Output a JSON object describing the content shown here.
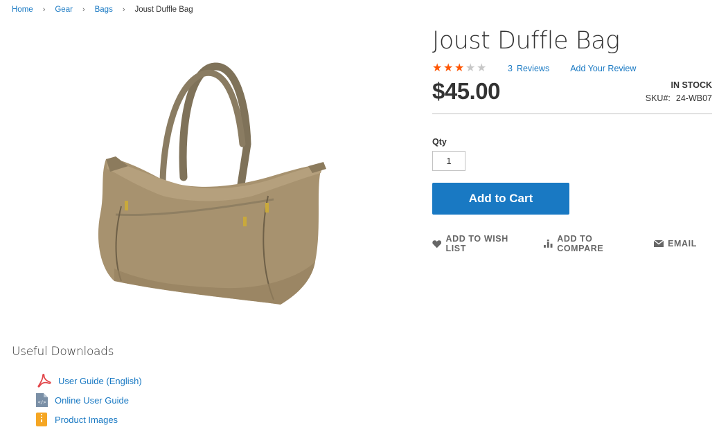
{
  "breadcrumbs": {
    "items": [
      "Home",
      "Gear",
      "Bags"
    ],
    "separator": "›",
    "current": "Joust Duffle Bag"
  },
  "product": {
    "title": "Joust Duffle Bag",
    "rating": 3,
    "rating_max": 5,
    "reviews_count": "3",
    "reviews_label": "Reviews",
    "add_review_label": "Add Your Review",
    "price": "$45.00",
    "stock_status": "IN STOCK",
    "sku_label": "SKU#:",
    "sku": "24-WB07",
    "image_icon": "duffle-bag-image"
  },
  "purchase": {
    "qty_label": "Qty",
    "qty_value": "1",
    "add_to_cart_label": "Add to Cart"
  },
  "actions": {
    "wishlist_label": "ADD TO WISH LIST",
    "compare_label": "ADD TO COMPARE",
    "email_label": "EMAIL"
  },
  "downloads": {
    "title": "Useful Downloads",
    "items": [
      {
        "label": "User Guide (English)",
        "icon": "pdf-icon"
      },
      {
        "label": "Online User Guide",
        "icon": "code-file-icon"
      },
      {
        "label": "Product Images",
        "icon": "zip-file-icon"
      }
    ]
  },
  "colors": {
    "link": "#1979c3",
    "primary_button": "#1979c3",
    "star_on": "#ff5501",
    "star_off": "#c7c7c7",
    "text": "#333333"
  }
}
